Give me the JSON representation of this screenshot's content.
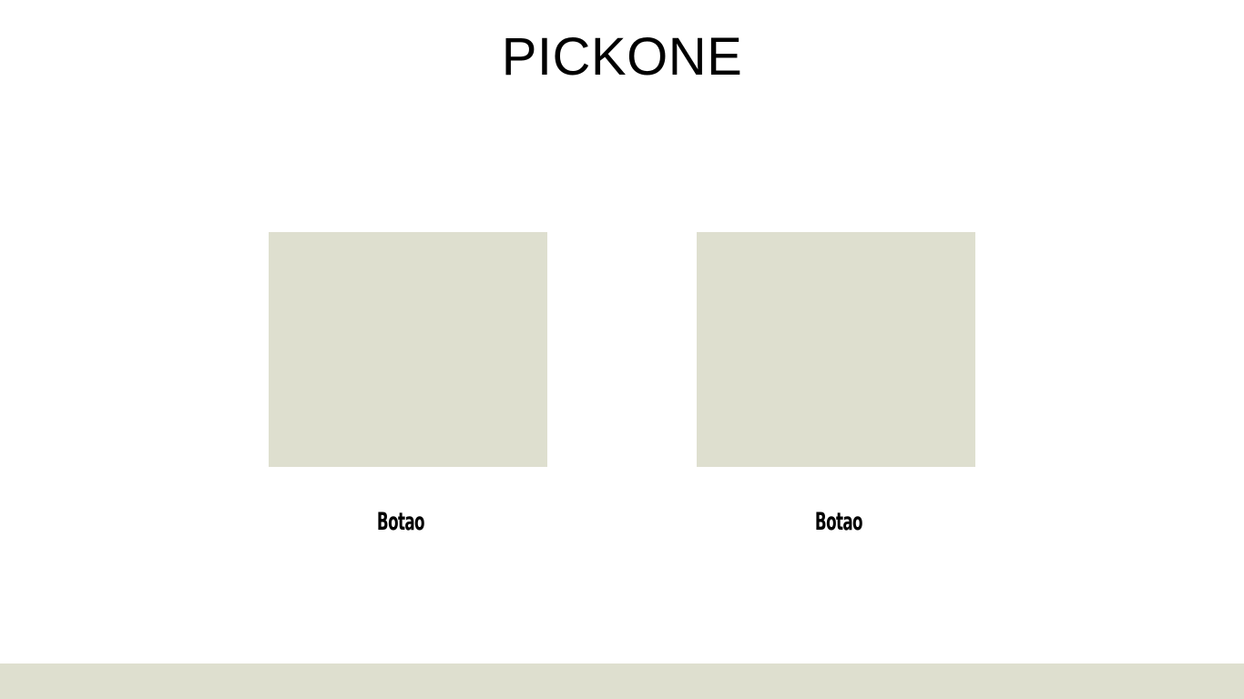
{
  "header": {
    "title": "PICKONE"
  },
  "options": [
    {
      "label": "Botao"
    },
    {
      "label": "Botao"
    }
  ],
  "colors": {
    "card_background": "#dedfcf",
    "footer_background": "#dedfcf",
    "page_background": "#ffffff",
    "text": "#000000"
  }
}
